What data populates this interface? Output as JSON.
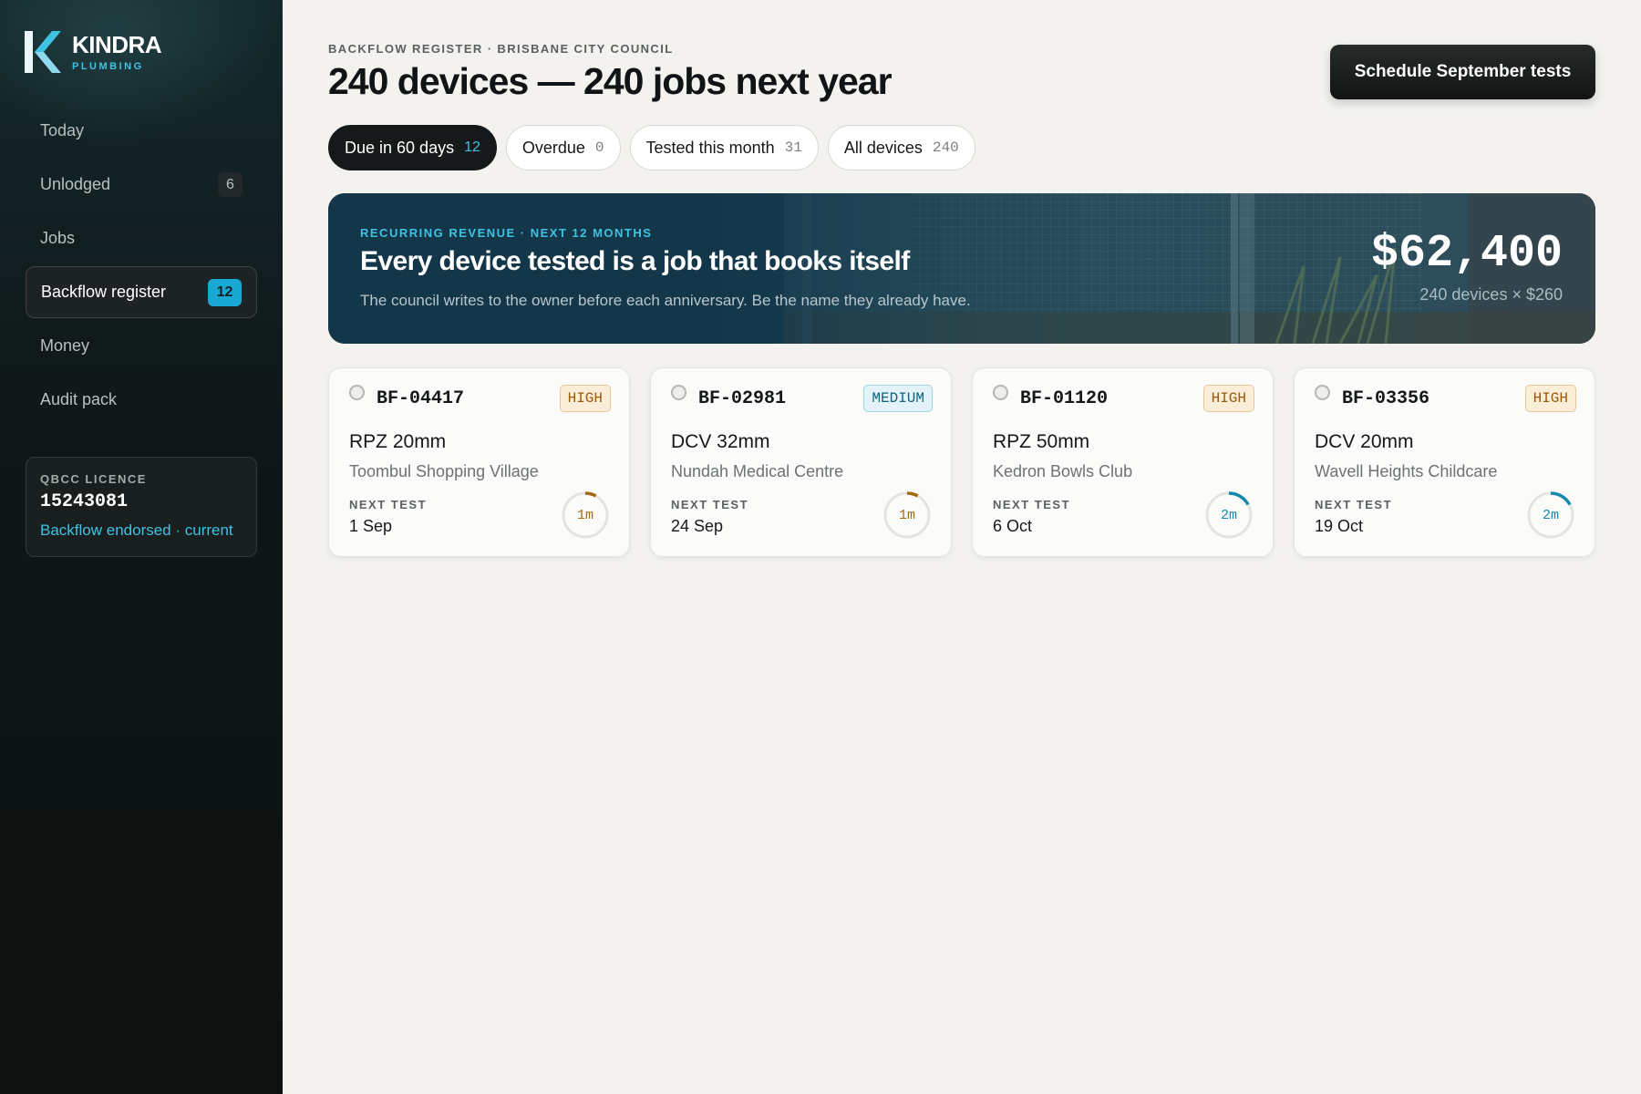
{
  "brand": {
    "name": "KINDRA",
    "sub": "PLUMBING"
  },
  "sidebar": {
    "items": [
      {
        "label": "Today",
        "count": null,
        "active": false
      },
      {
        "label": "Unlodged",
        "count": "6",
        "active": false
      },
      {
        "label": "Jobs",
        "count": null,
        "active": false
      },
      {
        "label": "Backflow register",
        "count": "12",
        "active": true
      },
      {
        "label": "Money",
        "count": null,
        "active": false
      },
      {
        "label": "Audit pack",
        "count": null,
        "active": false
      }
    ],
    "licence": {
      "label": "QBCC LICENCE",
      "number": "15243081",
      "status": "Backflow endorsed · current"
    }
  },
  "header": {
    "eyebrow": "BACKFLOW REGISTER · BRISBANE CITY COUNCIL",
    "title": "240 devices — 240 jobs next year",
    "action_label": "Schedule September tests"
  },
  "filters": [
    {
      "label": "Due in 60 days",
      "count": "12",
      "active": true
    },
    {
      "label": "Overdue",
      "count": "0",
      "active": false
    },
    {
      "label": "Tested this month",
      "count": "31",
      "active": false
    },
    {
      "label": "All devices",
      "count": "240",
      "active": false
    }
  ],
  "banner": {
    "tag": "RECURRING REVENUE · NEXT 12 MONTHS",
    "title": "Every device tested is a job that books itself",
    "description": "The council writes to the owner before each anniversary. Be the name they already have.",
    "amount": "$62,400",
    "calc": "240 devices × $260"
  },
  "devices": [
    {
      "id": "BF-04417",
      "risk": "HIGH",
      "type": "RPZ 20mm",
      "site": "Toombul Shopping Village",
      "next_label": "NEXT TEST",
      "next_date": "1 Sep",
      "due_in": "1m",
      "ring_fraction": 0.08,
      "ring_color": "#a26a10"
    },
    {
      "id": "BF-02981",
      "risk": "MEDIUM",
      "type": "DCV 32mm",
      "site": "Nundah Medical Centre",
      "next_label": "NEXT TEST",
      "next_date": "24 Sep",
      "due_in": "1m",
      "ring_fraction": 0.08,
      "ring_color": "#a26a10"
    },
    {
      "id": "BF-01120",
      "risk": "HIGH",
      "type": "RPZ 50mm",
      "site": "Kedron Bowls Club",
      "next_label": "NEXT TEST",
      "next_date": "6 Oct",
      "due_in": "2m",
      "ring_fraction": 0.17,
      "ring_color": "#1789ad"
    },
    {
      "id": "BF-03356",
      "risk": "HIGH",
      "type": "DCV 20mm",
      "site": "Wavell Heights Childcare",
      "next_label": "NEXT TEST",
      "next_date": "19 Oct",
      "due_in": "2m",
      "ring_fraction": 0.17,
      "ring_color": "#1789ad"
    }
  ],
  "colors": {
    "accent": "#3fc2e2",
    "high_text": "#9a5a08",
    "medium_text": "#0d6580"
  }
}
